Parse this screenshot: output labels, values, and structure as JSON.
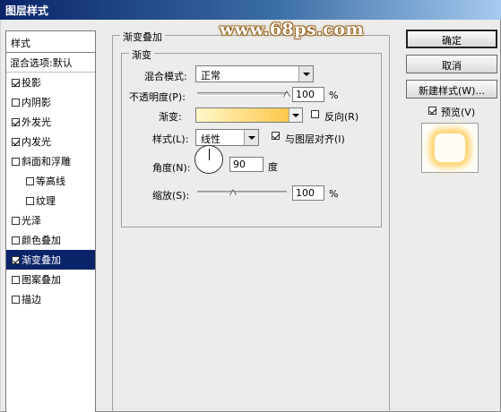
{
  "window": {
    "title": "图层样式"
  },
  "watermark": "www.68ps.com",
  "style_list": {
    "header": "样式",
    "blend_options": "混合选项:默认",
    "items": [
      {
        "label": "投影",
        "checked": true,
        "selected": false,
        "indent": false
      },
      {
        "label": "内阴影",
        "checked": false,
        "selected": false,
        "indent": false
      },
      {
        "label": "外发光",
        "checked": true,
        "selected": false,
        "indent": false
      },
      {
        "label": "内发光",
        "checked": true,
        "selected": false,
        "indent": false
      },
      {
        "label": "斜面和浮雕",
        "checked": false,
        "selected": false,
        "indent": false
      },
      {
        "label": "等高线",
        "checked": false,
        "selected": false,
        "indent": true
      },
      {
        "label": "纹理",
        "checked": false,
        "selected": false,
        "indent": true
      },
      {
        "label": "光泽",
        "checked": false,
        "selected": false,
        "indent": false
      },
      {
        "label": "颜色叠加",
        "checked": false,
        "selected": false,
        "indent": false
      },
      {
        "label": "渐变叠加",
        "checked": true,
        "selected": true,
        "indent": false
      },
      {
        "label": "图案叠加",
        "checked": false,
        "selected": false,
        "indent": false
      },
      {
        "label": "描边",
        "checked": false,
        "selected": false,
        "indent": false
      }
    ]
  },
  "panel": {
    "group_title": "渐变叠加",
    "subgroup_title": "渐变",
    "blend_mode_label": "混合模式:",
    "blend_mode_value": "正常",
    "opacity_label": "不透明度(P):",
    "opacity_value": "100",
    "opacity_unit": "%",
    "opacity_level": 1.0,
    "gradient_label": "渐变:",
    "gradient_colors": [
      "#fff8c8",
      "#ffc74a"
    ],
    "reverse_label": "反向(R)",
    "reverse_checked": false,
    "style_label": "样式(L):",
    "style_value": "线性",
    "align_label": "与图层对齐(I)",
    "align_checked": true,
    "angle_label": "角度(N):",
    "angle_value": "90",
    "angle_unit": "度",
    "scale_label": "缩放(S):",
    "scale_value": "100",
    "scale_unit": "%",
    "scale_level": 0.4
  },
  "buttons": {
    "ok": "确定",
    "cancel": "取消",
    "new_style": "新建样式(W)..."
  },
  "preview": {
    "label": "预览(V)",
    "checked": true
  }
}
